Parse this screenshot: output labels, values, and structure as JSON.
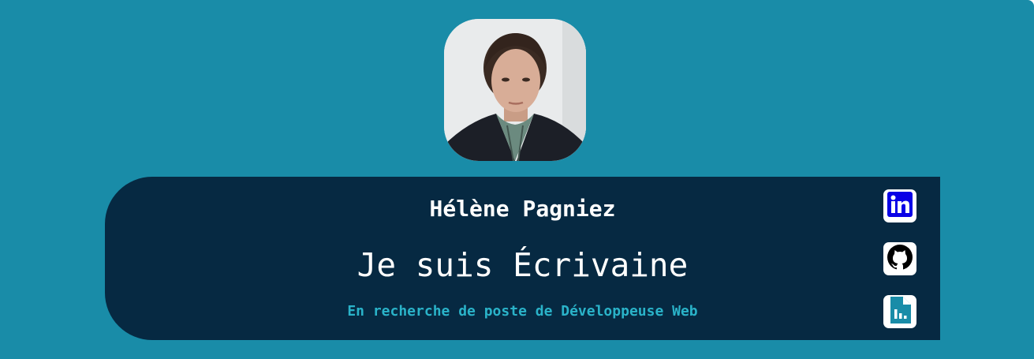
{
  "profile": {
    "name": "Hélène Pagniez",
    "headline": "Je suis Écrivaine",
    "tagline": "En recherche de poste de Développeuse Web"
  },
  "social_links": [
    {
      "icon": "linkedin-icon",
      "color": "#0a00e6"
    },
    {
      "icon": "github-icon",
      "color": "#000000"
    },
    {
      "icon": "resume-file-icon",
      "color": "#198ca8"
    }
  ],
  "colors": {
    "background": "#198ca8",
    "card": "#062942",
    "accent": "#2ab3c9",
    "text": "#ffffff"
  }
}
